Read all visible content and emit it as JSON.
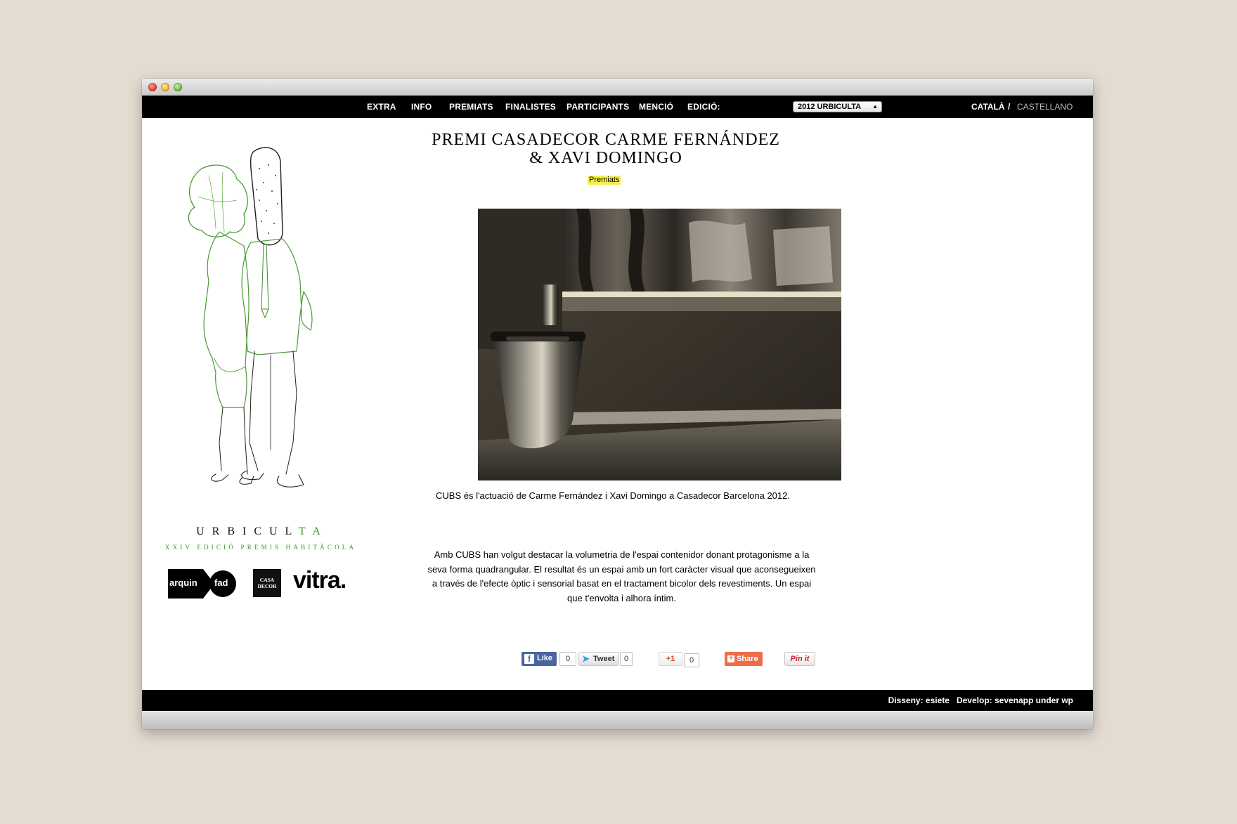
{
  "nav": {
    "items": [
      "EXTRA",
      "INFO",
      "PREMIATS",
      "FINALISTES",
      "PARTICIPANTS",
      "MENCIÓ"
    ],
    "edition_label": "EDICIÓ:",
    "edition_value": "2012 URBICULTA"
  },
  "languages": {
    "catala": "CATALÀ",
    "separator": "/",
    "castellano": "CASTELLANO"
  },
  "brand": {
    "name_dark": "URBICUL",
    "name_green": "TA",
    "subtitle": "XXIV EDICIÓ PREMIS HABITÀCOLA",
    "logos": {
      "arquin": "arquin",
      "fad": "fad",
      "casadecor_line1": "CASA",
      "casadecor_line2": "DECOR",
      "vitra": "vitra."
    }
  },
  "post": {
    "title": "PREMI CASADECOR CARME FERNÁNDEZ & XAVI DOMINGO",
    "category": "Premiats",
    "caption": "CUBS és l'actuació de Carme Fernández i Xavi Domingo a Casadecor Barcelona 2012.",
    "body": "Amb CUBS han volgut destacar la volumetria de l'espai contenidor donant protagonisme a la seva forma quadrangular. El resultat és un espai amb un fort caràcter visual que aconsegueixen a través de l'efecte òptic i sensorial basat en el tractament bicolor dels revestiments. Un espai que t'envolta i alhora íntim."
  },
  "social": {
    "like_label": "Like",
    "like_count": "0",
    "tweet_label": "Tweet",
    "tweet_count": "0",
    "gplus_label": "+1",
    "gplus_count": "0",
    "share_label": "Share",
    "pin_label": "Pin it"
  },
  "footer": {
    "credits": "Disseny: esiete   Develop: sevenapp under wp"
  },
  "colors": {
    "accent_green": "#3f8f2b",
    "highlight": "#f5f04a",
    "nav_bg": "#000000"
  }
}
